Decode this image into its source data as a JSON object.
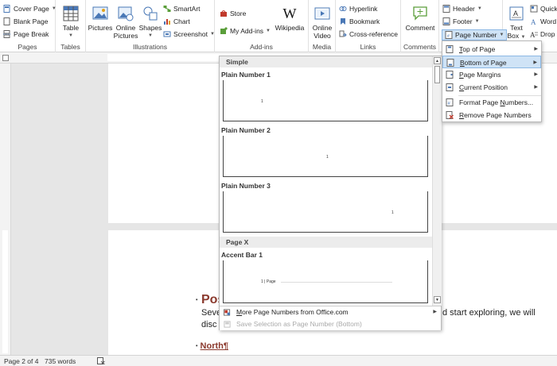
{
  "ribbon": {
    "pages_group": {
      "label": "Pages",
      "cover_page": "Cover Page",
      "blank_page": "Blank Page",
      "page_break": "Page Break"
    },
    "tables_group": {
      "label": "Tables",
      "table": "Table"
    },
    "illustrations_group": {
      "label": "Illustrations",
      "pictures": "Pictures",
      "online_pictures_1": "Online",
      "online_pictures_2": "Pictures",
      "shapes": "Shapes",
      "smartart": "SmartArt",
      "chart": "Chart",
      "screenshot": "Screenshot"
    },
    "addins_group": {
      "label": "Add-ins",
      "store": "Store",
      "my_addins": "My Add-ins",
      "wikipedia": "Wikipedia"
    },
    "media_group": {
      "label": "Media",
      "online_video_1": "Online",
      "online_video_2": "Video"
    },
    "links_group": {
      "label": "Links",
      "hyperlink": "Hyperlink",
      "bookmark": "Bookmark",
      "cross_reference": "Cross-reference"
    },
    "comments_group": {
      "label": "Comments",
      "comment": "Comment"
    },
    "header_footer_group": {
      "header": "Header",
      "footer": "Footer",
      "page_number": "Page Number"
    },
    "text_group": {
      "text_box_1": "Text",
      "text_box_2": "Box",
      "quick": "Quick",
      "word": "Word",
      "drop": "Drop"
    }
  },
  "page_number_menu": {
    "items": [
      {
        "label": "Top of Page",
        "accel": "T",
        "rest": "op of Page"
      },
      {
        "label": "Bottom of Page",
        "accel": "B",
        "rest": "ottom of Page"
      },
      {
        "label": "Page Margins",
        "accel": "P",
        "rest": "age Margins"
      },
      {
        "label": "Current Position",
        "accel": "C",
        "rest": "urrent Position"
      },
      {
        "label": "Format Page Numbers...",
        "pre": "Format Page ",
        "accel": "N",
        "rest": "umbers..."
      },
      {
        "label": "Remove Page Numbers",
        "accel": "R",
        "rest": "emove Page Numbers"
      }
    ]
  },
  "gallery": {
    "section_simple": "Simple",
    "plain1": "Plain Number 1",
    "plain2": "Plain Number 2",
    "plain3": "Plain Number 3",
    "section_pagex": "Page X",
    "accent1": "Accent Bar 1",
    "num": "1",
    "accent_text": "1 | Page",
    "more": "More Page Numbers from Office.com",
    "more_accel": "M",
    "more_rest": "ore Page Numbers from Office.com",
    "save_selection": "Save Selection as Page Number (Bottom)"
  },
  "document": {
    "heading1_partial": "Pos",
    "line1_left": "Seve",
    "line1_right": "d start exploring, we will",
    "line2_left": "disc",
    "heading2": "North¶"
  },
  "status": {
    "page": "Page 2 of 4",
    "words": "735 words"
  },
  "colors": {
    "highlight": "#cfe3f6",
    "heading": "#8b3a2e",
    "link": "#1f4e9b"
  }
}
